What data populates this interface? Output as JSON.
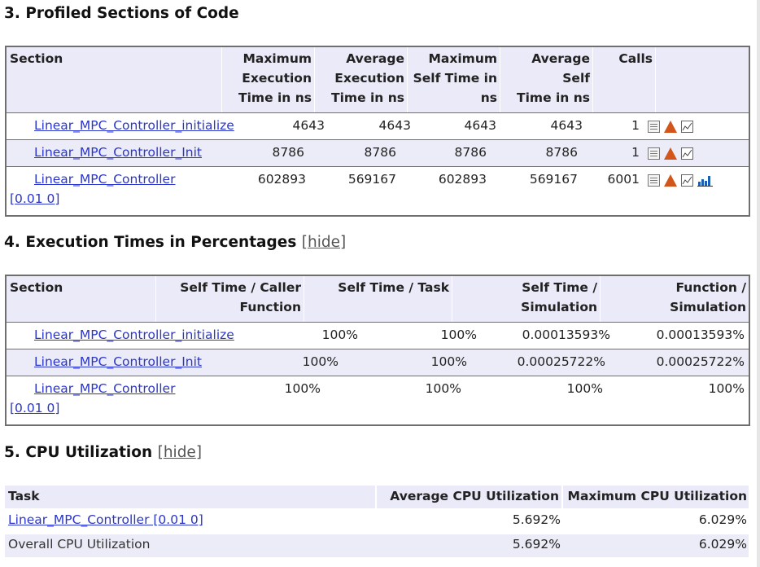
{
  "section3": {
    "title": "3. Profiled Sections of Code",
    "headers": {
      "section": "Section",
      "max_exec": [
        "Maximum",
        "Execution",
        "Time in ns"
      ],
      "avg_exec": [
        "Average",
        "Execution",
        "Time in ns"
      ],
      "max_self": [
        "Maximum",
        "Self Time in",
        "ns"
      ],
      "avg_self": [
        "Average Self",
        "Time in ns"
      ],
      "calls": "Calls"
    },
    "rows": [
      {
        "name": "Linear_MPC_Controller_initialize",
        "suffix": "",
        "max_exec": "4643",
        "avg_exec": "4643",
        "max_self": "4643",
        "avg_self": "4643",
        "calls": "1"
      },
      {
        "name": "Linear_MPC_Controller_Init",
        "suffix": "",
        "max_exec": "8786",
        "avg_exec": "8786",
        "max_self": "8786",
        "avg_self": "8786",
        "calls": "1"
      },
      {
        "name": "Linear_MPC_Controller",
        "suffix": "[0.01 0]",
        "max_exec": "602893",
        "avg_exec": "569167",
        "max_self": "602893",
        "avg_self": "569167",
        "calls": "6001"
      }
    ],
    "icons": [
      "report-icon",
      "matlab-icon",
      "plot-icon",
      "bar-chart-icon"
    ],
    "accent": "#ececf8"
  },
  "section4": {
    "title": "4. Execution Times in Percentages",
    "hide_label": "hide",
    "headers": {
      "section": "Section",
      "self_caller": [
        "Self Time / Caller",
        "Function"
      ],
      "self_task": "Self Time / Task",
      "self_sim": [
        "Self Time /",
        "Simulation"
      ],
      "func_sim": [
        "Function /",
        "Simulation"
      ]
    },
    "rows": [
      {
        "name": "Linear_MPC_Controller_initialize",
        "suffix": "",
        "self_caller": "100%",
        "self_task": "100%",
        "self_sim": "0.00013593%",
        "func_sim": "0.00013593%"
      },
      {
        "name": "Linear_MPC_Controller_Init",
        "suffix": "",
        "self_caller": "100%",
        "self_task": "100%",
        "self_sim": "0.00025722%",
        "func_sim": "0.00025722%"
      },
      {
        "name": "Linear_MPC_Controller",
        "suffix": "[0.01 0]",
        "self_caller": "100%",
        "self_task": "100%",
        "self_sim": "100%",
        "func_sim": "100%"
      }
    ]
  },
  "section5": {
    "title": "5. CPU Utilization",
    "hide_label": "hide",
    "headers": {
      "task": "Task",
      "avg": "Average CPU Utilization",
      "max": "Maximum CPU Utilization"
    },
    "rows": [
      {
        "task": "Linear_MPC_Controller [0.01 0]",
        "avg": "5.692%",
        "max": "6.029%"
      },
      {
        "task": "Overall CPU Utilization",
        "avg": "5.692%",
        "max": "6.029%"
      }
    ]
  }
}
